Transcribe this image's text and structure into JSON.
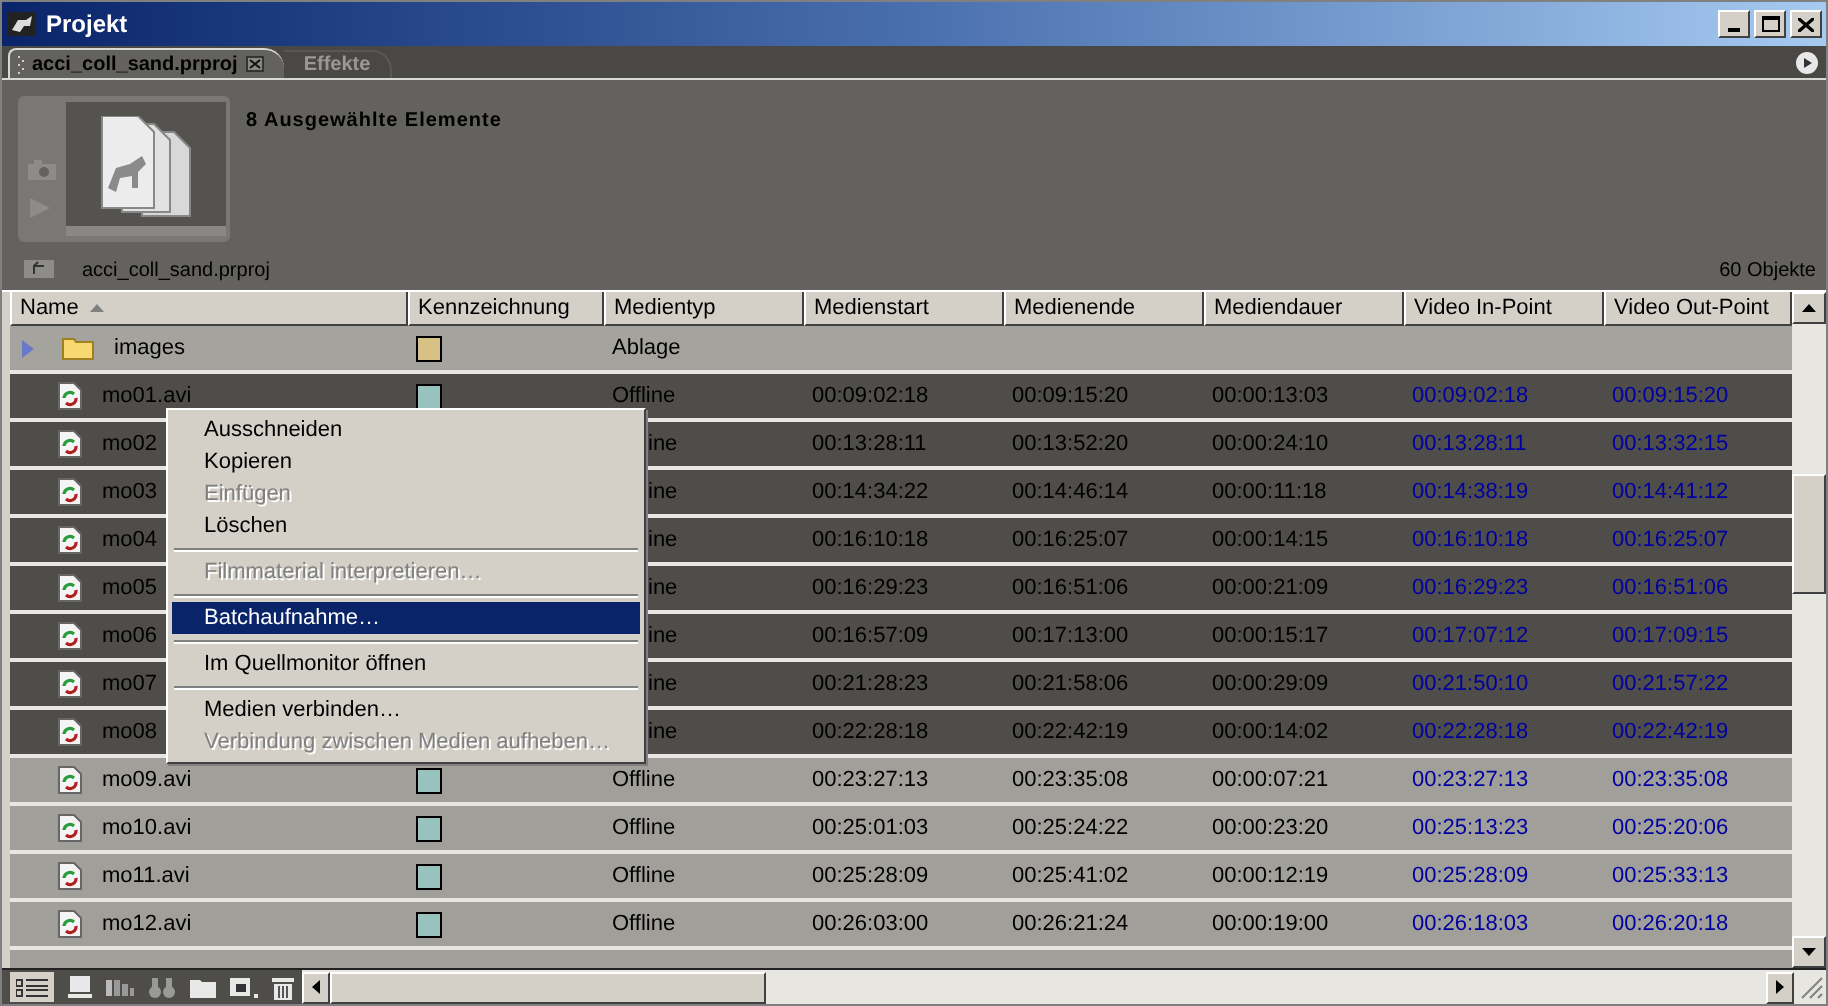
{
  "window": {
    "title": "Projekt"
  },
  "tabs": [
    {
      "label": "acci_coll_sand.prproj",
      "selected": true
    },
    {
      "label": "Effekte",
      "selected": false
    }
  ],
  "preview": {
    "heading": "8 Ausgewählte Elemente",
    "path": "acci_coll_sand.prproj",
    "count": "60 Objekte"
  },
  "table": {
    "columns": [
      {
        "label": "Name",
        "sorted": true
      },
      {
        "label": "Kennzeichnung",
        "sorted": false
      },
      {
        "label": "Medientyp",
        "sorted": false
      },
      {
        "label": "Medienstart",
        "sorted": false
      },
      {
        "label": "Medienende",
        "sorted": false
      },
      {
        "label": "Mediendauer",
        "sorted": false
      },
      {
        "label": "Video In-Point",
        "sorted": false
      },
      {
        "label": "Video Out-Point",
        "sorted": false
      }
    ],
    "rows": [
      {
        "kind": "folder",
        "name": "images",
        "color": "#d8c184",
        "type": "Ablage",
        "selected": false,
        "expanded": false
      },
      {
        "kind": "clip",
        "name": "mo01.avi",
        "color": "#97c2bd",
        "type": "Offline",
        "start": "00:09:02:18",
        "end": "00:09:15:20",
        "duration": "00:00:13:03",
        "in": "00:09:02:18",
        "out": "00:09:15:20",
        "selected": true
      },
      {
        "kind": "clip",
        "name": "mo02",
        "type": "ine",
        "start": "00:13:28:11",
        "end": "00:13:52:20",
        "duration": "00:00:24:10",
        "in": "00:13:28:11",
        "out": "00:13:32:15",
        "selected": true
      },
      {
        "kind": "clip",
        "name": "mo03",
        "type": "ine",
        "start": "00:14:34:22",
        "end": "00:14:46:14",
        "duration": "00:00:11:18",
        "in": "00:14:38:19",
        "out": "00:14:41:12",
        "selected": true
      },
      {
        "kind": "clip",
        "name": "mo04",
        "type": "ine",
        "start": "00:16:10:18",
        "end": "00:16:25:07",
        "duration": "00:00:14:15",
        "in": "00:16:10:18",
        "out": "00:16:25:07",
        "selected": true
      },
      {
        "kind": "clip",
        "name": "mo05",
        "type": "ine",
        "start": "00:16:29:23",
        "end": "00:16:51:06",
        "duration": "00:00:21:09",
        "in": "00:16:29:23",
        "out": "00:16:51:06",
        "selected": true
      },
      {
        "kind": "clip",
        "name": "mo06",
        "type": "ine",
        "start": "00:16:57:09",
        "end": "00:17:13:00",
        "duration": "00:00:15:17",
        "in": "00:17:07:12",
        "out": "00:17:09:15",
        "selected": true
      },
      {
        "kind": "clip",
        "name": "mo07",
        "type": "ine",
        "start": "00:21:28:23",
        "end": "00:21:58:06",
        "duration": "00:00:29:09",
        "in": "00:21:50:10",
        "out": "00:21:57:22",
        "selected": true
      },
      {
        "kind": "clip",
        "name": "mo08",
        "type": "ine",
        "start": "00:22:28:18",
        "end": "00:22:42:19",
        "duration": "00:00:14:02",
        "in": "00:22:28:18",
        "out": "00:22:42:19",
        "selected": true
      },
      {
        "kind": "clip",
        "name": "mo09.avi",
        "color": "#97c2bd",
        "type": "Offline",
        "start": "00:23:27:13",
        "end": "00:23:35:08",
        "duration": "00:00:07:21",
        "in": "00:23:27:13",
        "out": "00:23:35:08",
        "selected": false
      },
      {
        "kind": "clip",
        "name": "mo10.avi",
        "color": "#97c2bd",
        "type": "Offline",
        "start": "00:25:01:03",
        "end": "00:25:24:22",
        "duration": "00:00:23:20",
        "in": "00:25:13:23",
        "out": "00:25:20:06",
        "selected": false
      },
      {
        "kind": "clip",
        "name": "mo11.avi",
        "color": "#97c2bd",
        "type": "Offline",
        "start": "00:25:28:09",
        "end": "00:25:41:02",
        "duration": "00:00:12:19",
        "in": "00:25:28:09",
        "out": "00:25:33:13",
        "selected": false
      },
      {
        "kind": "clip",
        "name": "mo12.avi",
        "color": "#97c2bd",
        "type": "Offline",
        "start": "00:26:03:00",
        "end": "00:26:21:24",
        "duration": "00:00:19:00",
        "in": "00:26:18:03",
        "out": "00:26:20:18",
        "selected": false
      }
    ]
  },
  "context_menu": {
    "items": [
      {
        "kind": "item",
        "label": "Ausschneiden",
        "disabled": false,
        "selected": false
      },
      {
        "kind": "item",
        "label": "Kopieren",
        "disabled": false,
        "selected": false
      },
      {
        "kind": "item",
        "label": "Einfügen",
        "disabled": true,
        "selected": false
      },
      {
        "kind": "item",
        "label": "Löschen",
        "disabled": false,
        "selected": false
      },
      {
        "kind": "separator"
      },
      {
        "kind": "item",
        "label": "Filmmaterial interpretieren…",
        "disabled": true,
        "selected": false
      },
      {
        "kind": "separator"
      },
      {
        "kind": "item",
        "label": "Batchaufnahme…",
        "disabled": false,
        "selected": true
      },
      {
        "kind": "separator"
      },
      {
        "kind": "item",
        "label": "Im Quellmonitor öffnen",
        "disabled": false,
        "selected": false
      },
      {
        "kind": "separator"
      },
      {
        "kind": "item",
        "label": "Medien verbinden…",
        "disabled": false,
        "selected": false
      },
      {
        "kind": "item",
        "label": "Verbindung zwischen Medien aufheben…",
        "disabled": true,
        "selected": false
      }
    ]
  }
}
